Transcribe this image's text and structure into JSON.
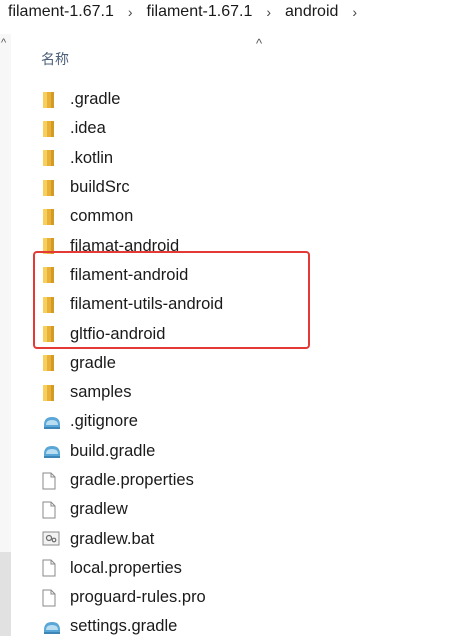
{
  "breadcrumb": [
    {
      "label": "filament-1.67.1"
    },
    {
      "label": "filament-1.67.1"
    },
    {
      "label": "android"
    }
  ],
  "breadcrumb_separator": "›",
  "column_header": {
    "name": "名称"
  },
  "sort_indicator": "^",
  "nav": {
    "up_arrow": "^"
  },
  "highlight": {
    "color": "#e53935"
  },
  "files": [
    {
      "name": ".gradle",
      "icon": "folder-icon"
    },
    {
      "name": ".idea",
      "icon": "folder-icon"
    },
    {
      "name": ".kotlin",
      "icon": "folder-icon"
    },
    {
      "name": "buildSrc",
      "icon": "folder-icon"
    },
    {
      "name": "common",
      "icon": "folder-icon"
    },
    {
      "name": "filamat-android",
      "icon": "folder-icon"
    },
    {
      "name": "filament-android",
      "icon": "folder-icon"
    },
    {
      "name": "filament-utils-android",
      "icon": "folder-icon"
    },
    {
      "name": "gltfio-android",
      "icon": "folder-icon"
    },
    {
      "name": "gradle",
      "icon": "folder-icon"
    },
    {
      "name": "samples",
      "icon": "folder-icon"
    },
    {
      "name": ".gitignore",
      "icon": "gradle-file-icon"
    },
    {
      "name": "build.gradle",
      "icon": "gradle-file-icon"
    },
    {
      "name": "gradle.properties",
      "icon": "blank-file-icon"
    },
    {
      "name": "gradlew",
      "icon": "blank-file-icon"
    },
    {
      "name": "gradlew.bat",
      "icon": "bat-file-icon"
    },
    {
      "name": "local.properties",
      "icon": "blank-file-icon"
    },
    {
      "name": "proguard-rules.pro",
      "icon": "blank-file-icon"
    },
    {
      "name": "settings.gradle",
      "icon": "gradle-file-icon"
    }
  ]
}
